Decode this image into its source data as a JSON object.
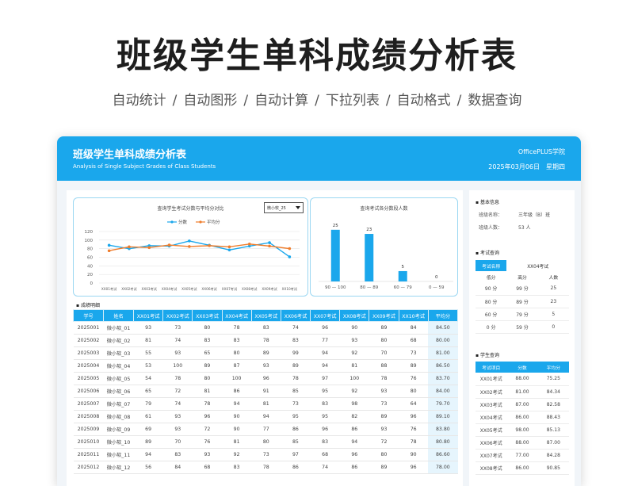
{
  "hero": {
    "title": "班级学生单科成绩分析表",
    "features": [
      "自动统计",
      "/",
      "自动图形",
      "/",
      "自动计算",
      "/",
      "下拉列表",
      "/",
      "自动格式",
      "/",
      "数据查询"
    ]
  },
  "header": {
    "title": "班级学生单科成绩分析表",
    "subtitle": "Analysis of Single Subject Grades of Class Students",
    "org": "OfficePLUS学院",
    "date": "2025年03月06日",
    "weekday": "星期四"
  },
  "colors": {
    "accent": "#1aa7ec",
    "score": "#1aa7ec",
    "avg": "#ef7d2c",
    "headerText": "#ffffff"
  },
  "left_chart": {
    "title": "查询学生考试分数与平均分对比",
    "select": "微小软_25",
    "legend": [
      "分数",
      "平均分"
    ]
  },
  "right_chart": {
    "title": "查询考试各分数段人数"
  },
  "chart_data": [
    {
      "type": "line",
      "title": "查询学生考试分数与平均分对比",
      "categories": [
        "XX01考试",
        "XX02考试",
        "XX03考试",
        "XX04考试",
        "XX05考试",
        "XX06考试",
        "XX07考试",
        "XX08考试",
        "XX09考试",
        "XX10考试"
      ],
      "series": [
        {
          "name": "分数",
          "values": [
            88,
            80,
            87,
            86,
            98,
            88,
            77,
            86,
            94,
            61
          ]
        },
        {
          "name": "平均分",
          "values": [
            75.25,
            84.34,
            82.58,
            88.43,
            85.13,
            87.0,
            84.28,
            90.85,
            86.08,
            80.25
          ]
        }
      ],
      "ylim": [
        0,
        120
      ],
      "yticks": [
        0,
        20,
        40,
        60,
        80,
        100,
        120
      ],
      "grid": true,
      "legend": "top"
    },
    {
      "type": "bar",
      "title": "查询考试各分数段人数",
      "categories": [
        "90 — 100",
        "80 — 89",
        "60 — 79",
        "0 — 59"
      ],
      "values": [
        25,
        23,
        5,
        0
      ],
      "ylim": [
        0,
        28
      ]
    }
  ],
  "detail": {
    "label": "成绩明细",
    "headers": [
      "学号",
      "姓名",
      "XX01考试",
      "XX02考试",
      "XX03考试",
      "XX04考试",
      "XX05考试",
      "XX06考试",
      "XX07考试",
      "XX08考试",
      "XX09考试",
      "XX10考试",
      "平均分"
    ],
    "rows": [
      [
        "2025001",
        "微小软_01",
        "93",
        "73",
        "80",
        "78",
        "83",
        "74",
        "96",
        "90",
        "89",
        "84",
        "84.50"
      ],
      [
        "2025002",
        "微小软_02",
        "81",
        "74",
        "83",
        "83",
        "78",
        "83",
        "77",
        "93",
        "80",
        "68",
        "80.00"
      ],
      [
        "2025003",
        "微小软_03",
        "55",
        "93",
        "65",
        "80",
        "89",
        "99",
        "94",
        "92",
        "70",
        "73",
        "81.00"
      ],
      [
        "2025004",
        "微小软_04",
        "53",
        "100",
        "89",
        "87",
        "93",
        "89",
        "94",
        "81",
        "88",
        "89",
        "86.50"
      ],
      [
        "2025005",
        "微小软_05",
        "54",
        "78",
        "80",
        "100",
        "96",
        "78",
        "97",
        "100",
        "78",
        "76",
        "83.70"
      ],
      [
        "2025006",
        "微小软_06",
        "65",
        "72",
        "81",
        "86",
        "91",
        "85",
        "95",
        "92",
        "93",
        "80",
        "84.00"
      ],
      [
        "2025007",
        "微小软_07",
        "79",
        "74",
        "78",
        "94",
        "81",
        "73",
        "83",
        "98",
        "73",
        "64",
        "79.70"
      ],
      [
        "2025008",
        "微小软_08",
        "61",
        "93",
        "96",
        "90",
        "94",
        "95",
        "95",
        "82",
        "89",
        "96",
        "89.10"
      ],
      [
        "2025009",
        "微小软_09",
        "69",
        "93",
        "72",
        "90",
        "77",
        "86",
        "96",
        "86",
        "93",
        "76",
        "83.80"
      ],
      [
        "2025010",
        "微小软_10",
        "89",
        "70",
        "76",
        "81",
        "80",
        "85",
        "83",
        "94",
        "72",
        "78",
        "80.80"
      ],
      [
        "2025011",
        "微小软_11",
        "94",
        "83",
        "93",
        "92",
        "73",
        "97",
        "68",
        "96",
        "80",
        "90",
        "86.60"
      ],
      [
        "2025012",
        "微小软_12",
        "56",
        "84",
        "68",
        "83",
        "78",
        "86",
        "74",
        "86",
        "89",
        "96",
        "78.00"
      ]
    ]
  },
  "side": {
    "basic": {
      "label": "基本信息",
      "class_label": "班级名称：",
      "class_value": "三年级（B）班",
      "count_label": "班级人数：",
      "count_value": "53 人"
    },
    "exam": {
      "label": "考试查询",
      "field_label": "考试名称",
      "field_value": "XX04考试",
      "headers": [
        "低分",
        "高分",
        "人数"
      ],
      "rows": [
        [
          "90 分",
          "99 分",
          "25"
        ],
        [
          "80 分",
          "89 分",
          "23"
        ],
        [
          "60 分",
          "79 分",
          "5"
        ],
        [
          "0 分",
          "59 分",
          "0"
        ]
      ]
    },
    "student": {
      "label": "学生查询",
      "headers": [
        "考试项目",
        "分数",
        "平均分"
      ],
      "rows": [
        [
          "XX01考试",
          "88.00",
          "75.25"
        ],
        [
          "XX02考试",
          "81.00",
          "84.34"
        ],
        [
          "XX03考试",
          "87.00",
          "82.58"
        ],
        [
          "XX04考试",
          "86.00",
          "88.43"
        ],
        [
          "XX05考试",
          "98.00",
          "85.13"
        ],
        [
          "XX06考试",
          "88.00",
          "87.00"
        ],
        [
          "XX07考试",
          "77.00",
          "84.28"
        ],
        [
          "XX08考试",
          "86.00",
          "90.85"
        ]
      ]
    }
  }
}
